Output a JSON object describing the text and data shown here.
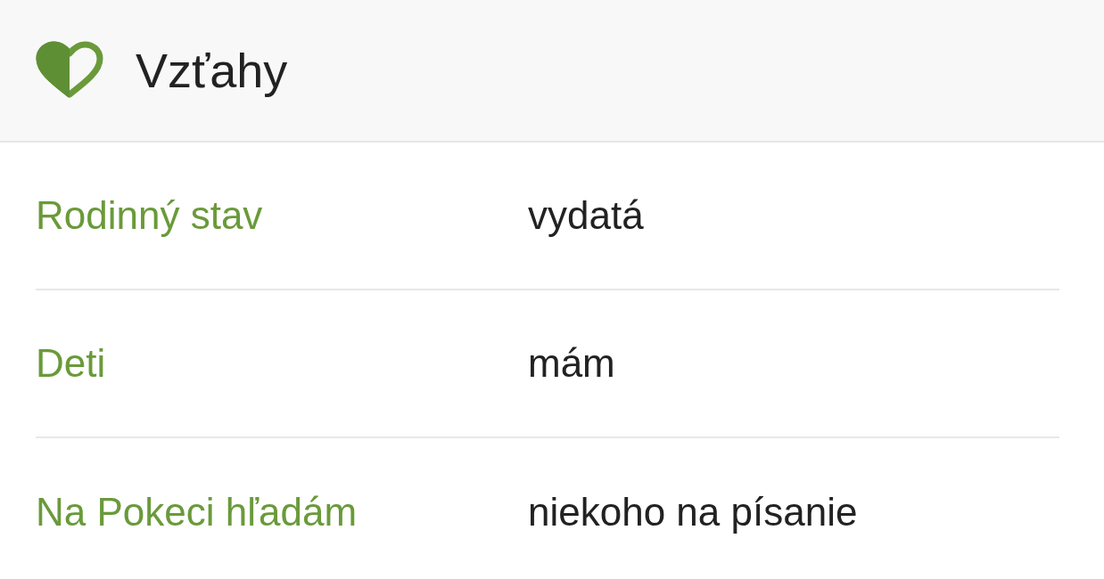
{
  "header": {
    "title": "Vzťahy"
  },
  "rows": [
    {
      "label": "Rodinný stav",
      "value": "vydatá"
    },
    {
      "label": "Deti",
      "value": "mám"
    },
    {
      "label": "Na Pokeci hľadám",
      "value": "niekoho na písanie"
    }
  ]
}
